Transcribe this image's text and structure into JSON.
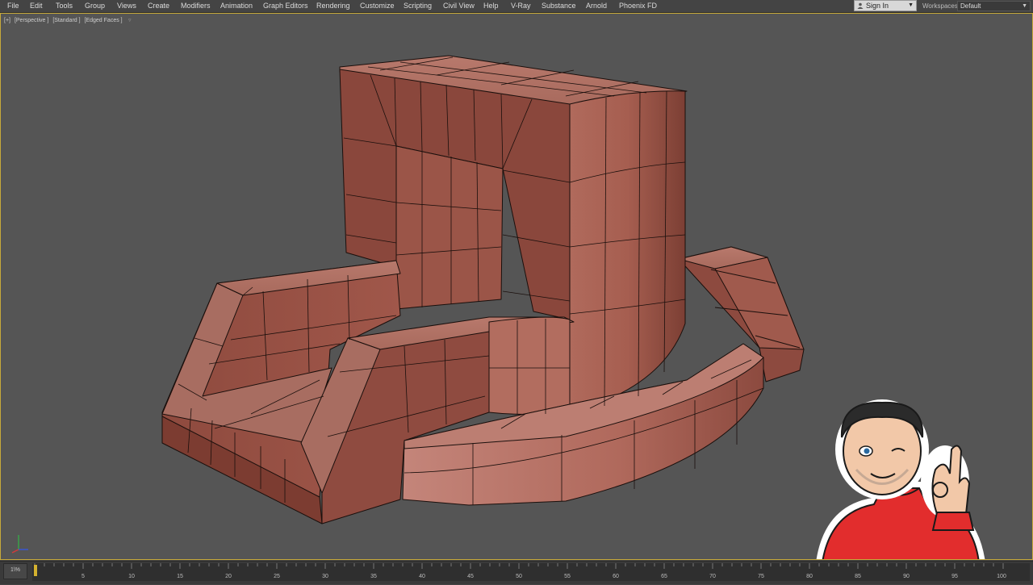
{
  "menu": [
    "File",
    "Edit",
    "Tools",
    "Group",
    "Views",
    "Create",
    "Modifiers",
    "Animation",
    "Graph Editors",
    "Rendering",
    "Customize",
    "Scripting",
    "Civil View",
    "Help",
    "V-Ray",
    "Substance",
    "Arnold",
    "Phoenix FD"
  ],
  "account": {
    "sign_in_label": "Sign In"
  },
  "workspaces": {
    "label": "Workspaces:",
    "value": "Default"
  },
  "viewport": {
    "labels": [
      "[+]",
      "[Perspective ]",
      "[Standard ]",
      "[Edged Faces ]"
    ]
  },
  "timeline": {
    "toggle_label": "1\\%",
    "tick_labels": [
      "5",
      "10",
      "15",
      "20",
      "25",
      "30",
      "35",
      "40",
      "45",
      "50",
      "55",
      "60",
      "65",
      "70",
      "75",
      "80",
      "85",
      "90",
      "95",
      "100"
    ]
  },
  "colors": {
    "accent": "#c7a93a",
    "mesh": "#a0574a",
    "viewport_bg": "#555555"
  },
  "icons": [
    "user-icon",
    "chevron-down-icon",
    "filter-icon",
    "axis-gizmo-icon"
  ]
}
